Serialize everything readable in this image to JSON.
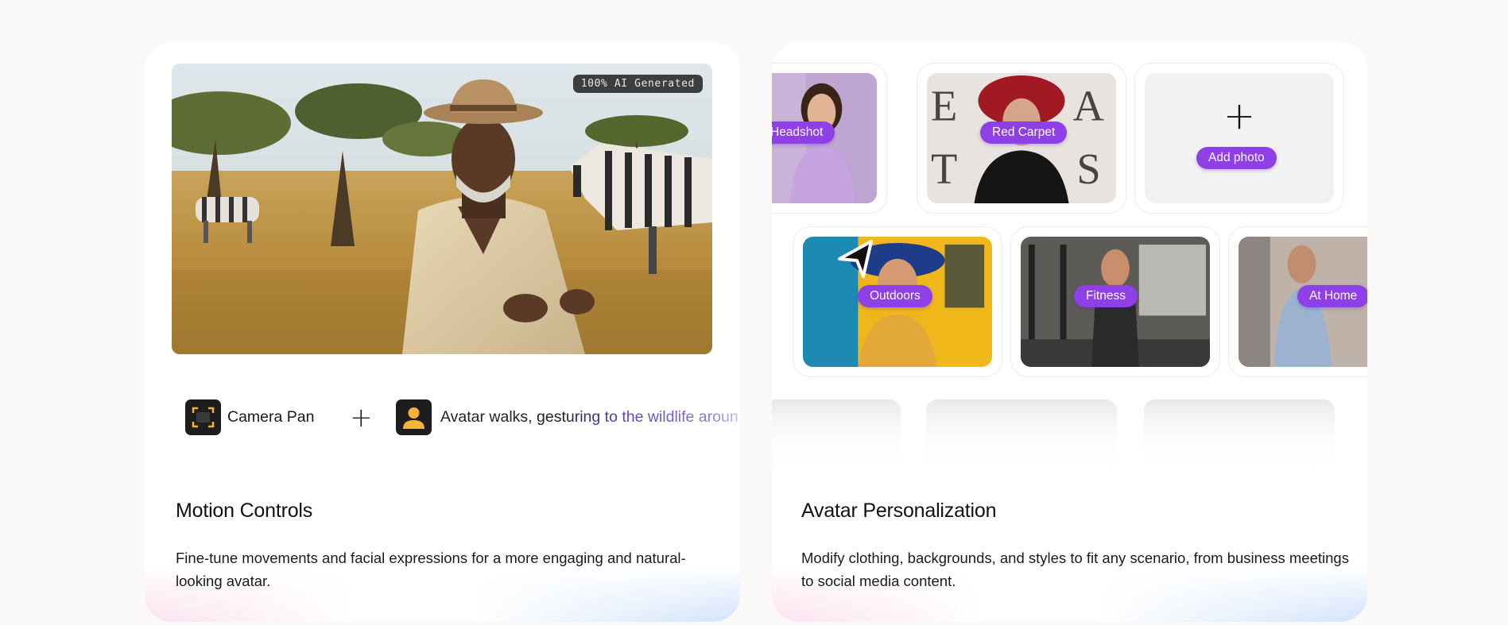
{
  "motion_card": {
    "title": "Motion Controls",
    "description": "Fine-tune movements and facial expressions for a more engaging and natural-looking avatar.",
    "video_badge": "100% AI Generated",
    "camera_label": "Camera Pan",
    "plus": "+",
    "prompt_text": "Avatar walks, gesturing to the wildlife aroun"
  },
  "avatar_card": {
    "title": "Avatar Personalization",
    "description": "Modify clothing, backgrounds, and styles to fit any scenario, from business meetings to social media content.",
    "tiles": [
      {
        "label": "Headshot"
      },
      {
        "label": "Red Carpet"
      },
      {
        "label": "Add photo"
      },
      {
        "label": "Outdoors"
      },
      {
        "label": "Fitness"
      },
      {
        "label": "At Home"
      }
    ],
    "add_plus": "+"
  },
  "colors": {
    "accent_purple": "#8e3fe6",
    "prompt_gradient_end": "#5b3cc4",
    "page_bg": "#faf9f8"
  }
}
